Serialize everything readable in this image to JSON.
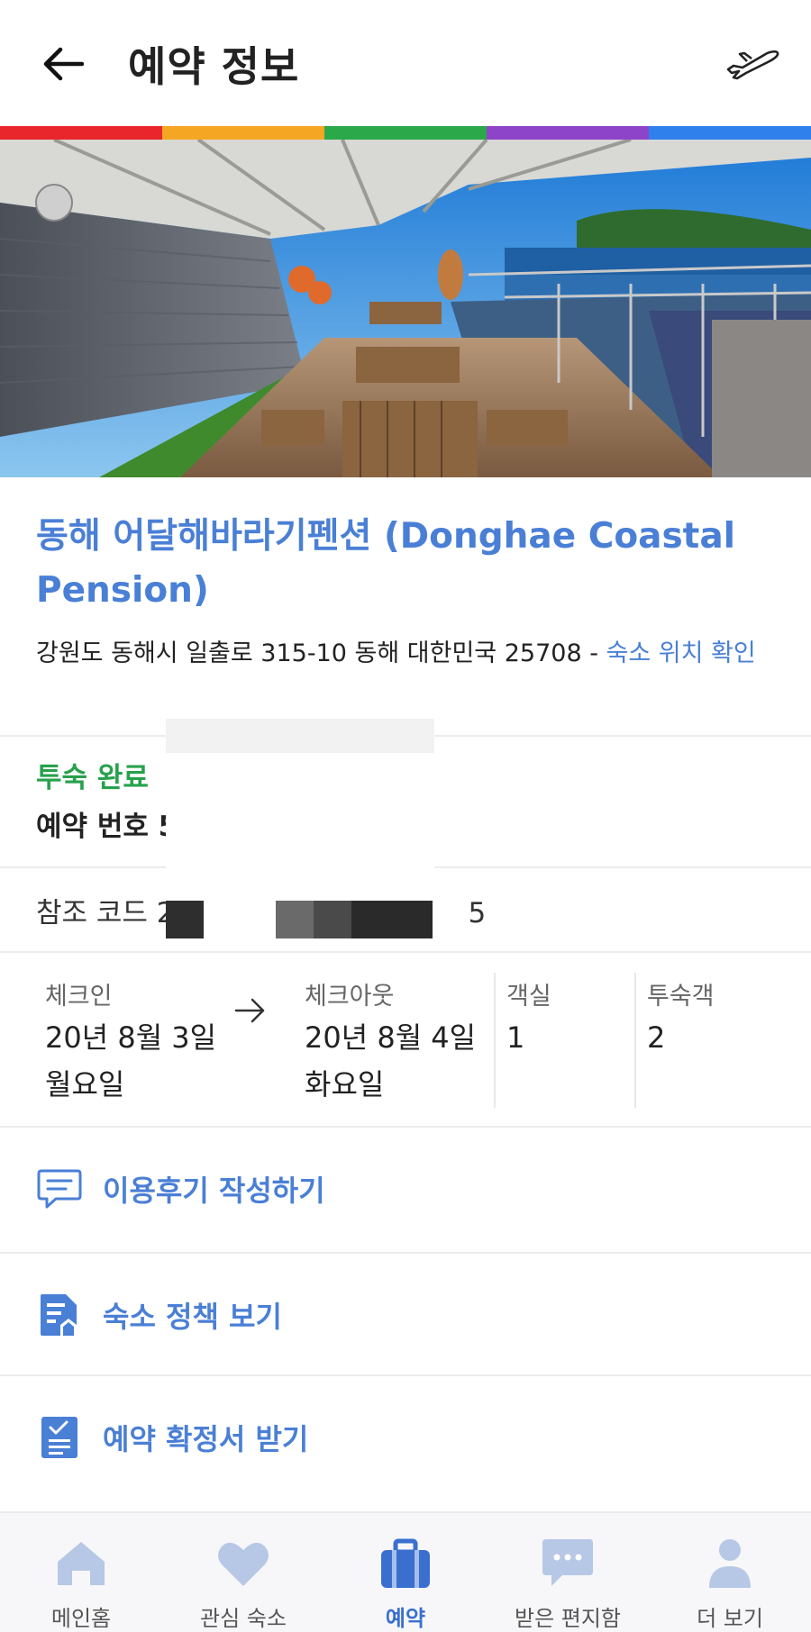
{
  "header": {
    "title": "예약 정보"
  },
  "colors": {
    "accent": "#4a7fd6",
    "success": "#27a14c",
    "rainbow": [
      "#e8262c",
      "#f5a623",
      "#2aa84a",
      "#8e44c9",
      "#2f80ed"
    ]
  },
  "hotel": {
    "name": "동해 어달해바라기펜션 (Donghae Coastal Pension)",
    "address": "강원도 동해시 일출로 315-10 동해 대한민국 25708 - ",
    "map_link": "숙소 위치 확인"
  },
  "booking": {
    "status": "투숙 완료",
    "reservation_label": "예약 번호 5",
    "reference_label": "참조 코드 2",
    "reference_tail": "5"
  },
  "stay": {
    "checkin_label": "체크인",
    "checkin_date": "20년 8월 3일",
    "checkin_day": "월요일",
    "checkout_label": "체크아웃",
    "checkout_date": "20년 8월 4일",
    "checkout_day": "화요일",
    "rooms_label": "객실",
    "rooms_value": "1",
    "guests_label": "투숙객",
    "guests_value": "2"
  },
  "actions": {
    "review": "이용후기 작성하기",
    "policy": "숙소 정책 보기",
    "confirmation": "예약 확정서 받기"
  },
  "nav": [
    {
      "label": "메인홈",
      "icon": "home-icon"
    },
    {
      "label": "관심 숙소",
      "icon": "heart-icon"
    },
    {
      "label": "예약",
      "icon": "suitcase-icon",
      "active": true
    },
    {
      "label": "받은 편지함",
      "icon": "chat-icon"
    },
    {
      "label": "더 보기",
      "icon": "person-icon"
    }
  ]
}
